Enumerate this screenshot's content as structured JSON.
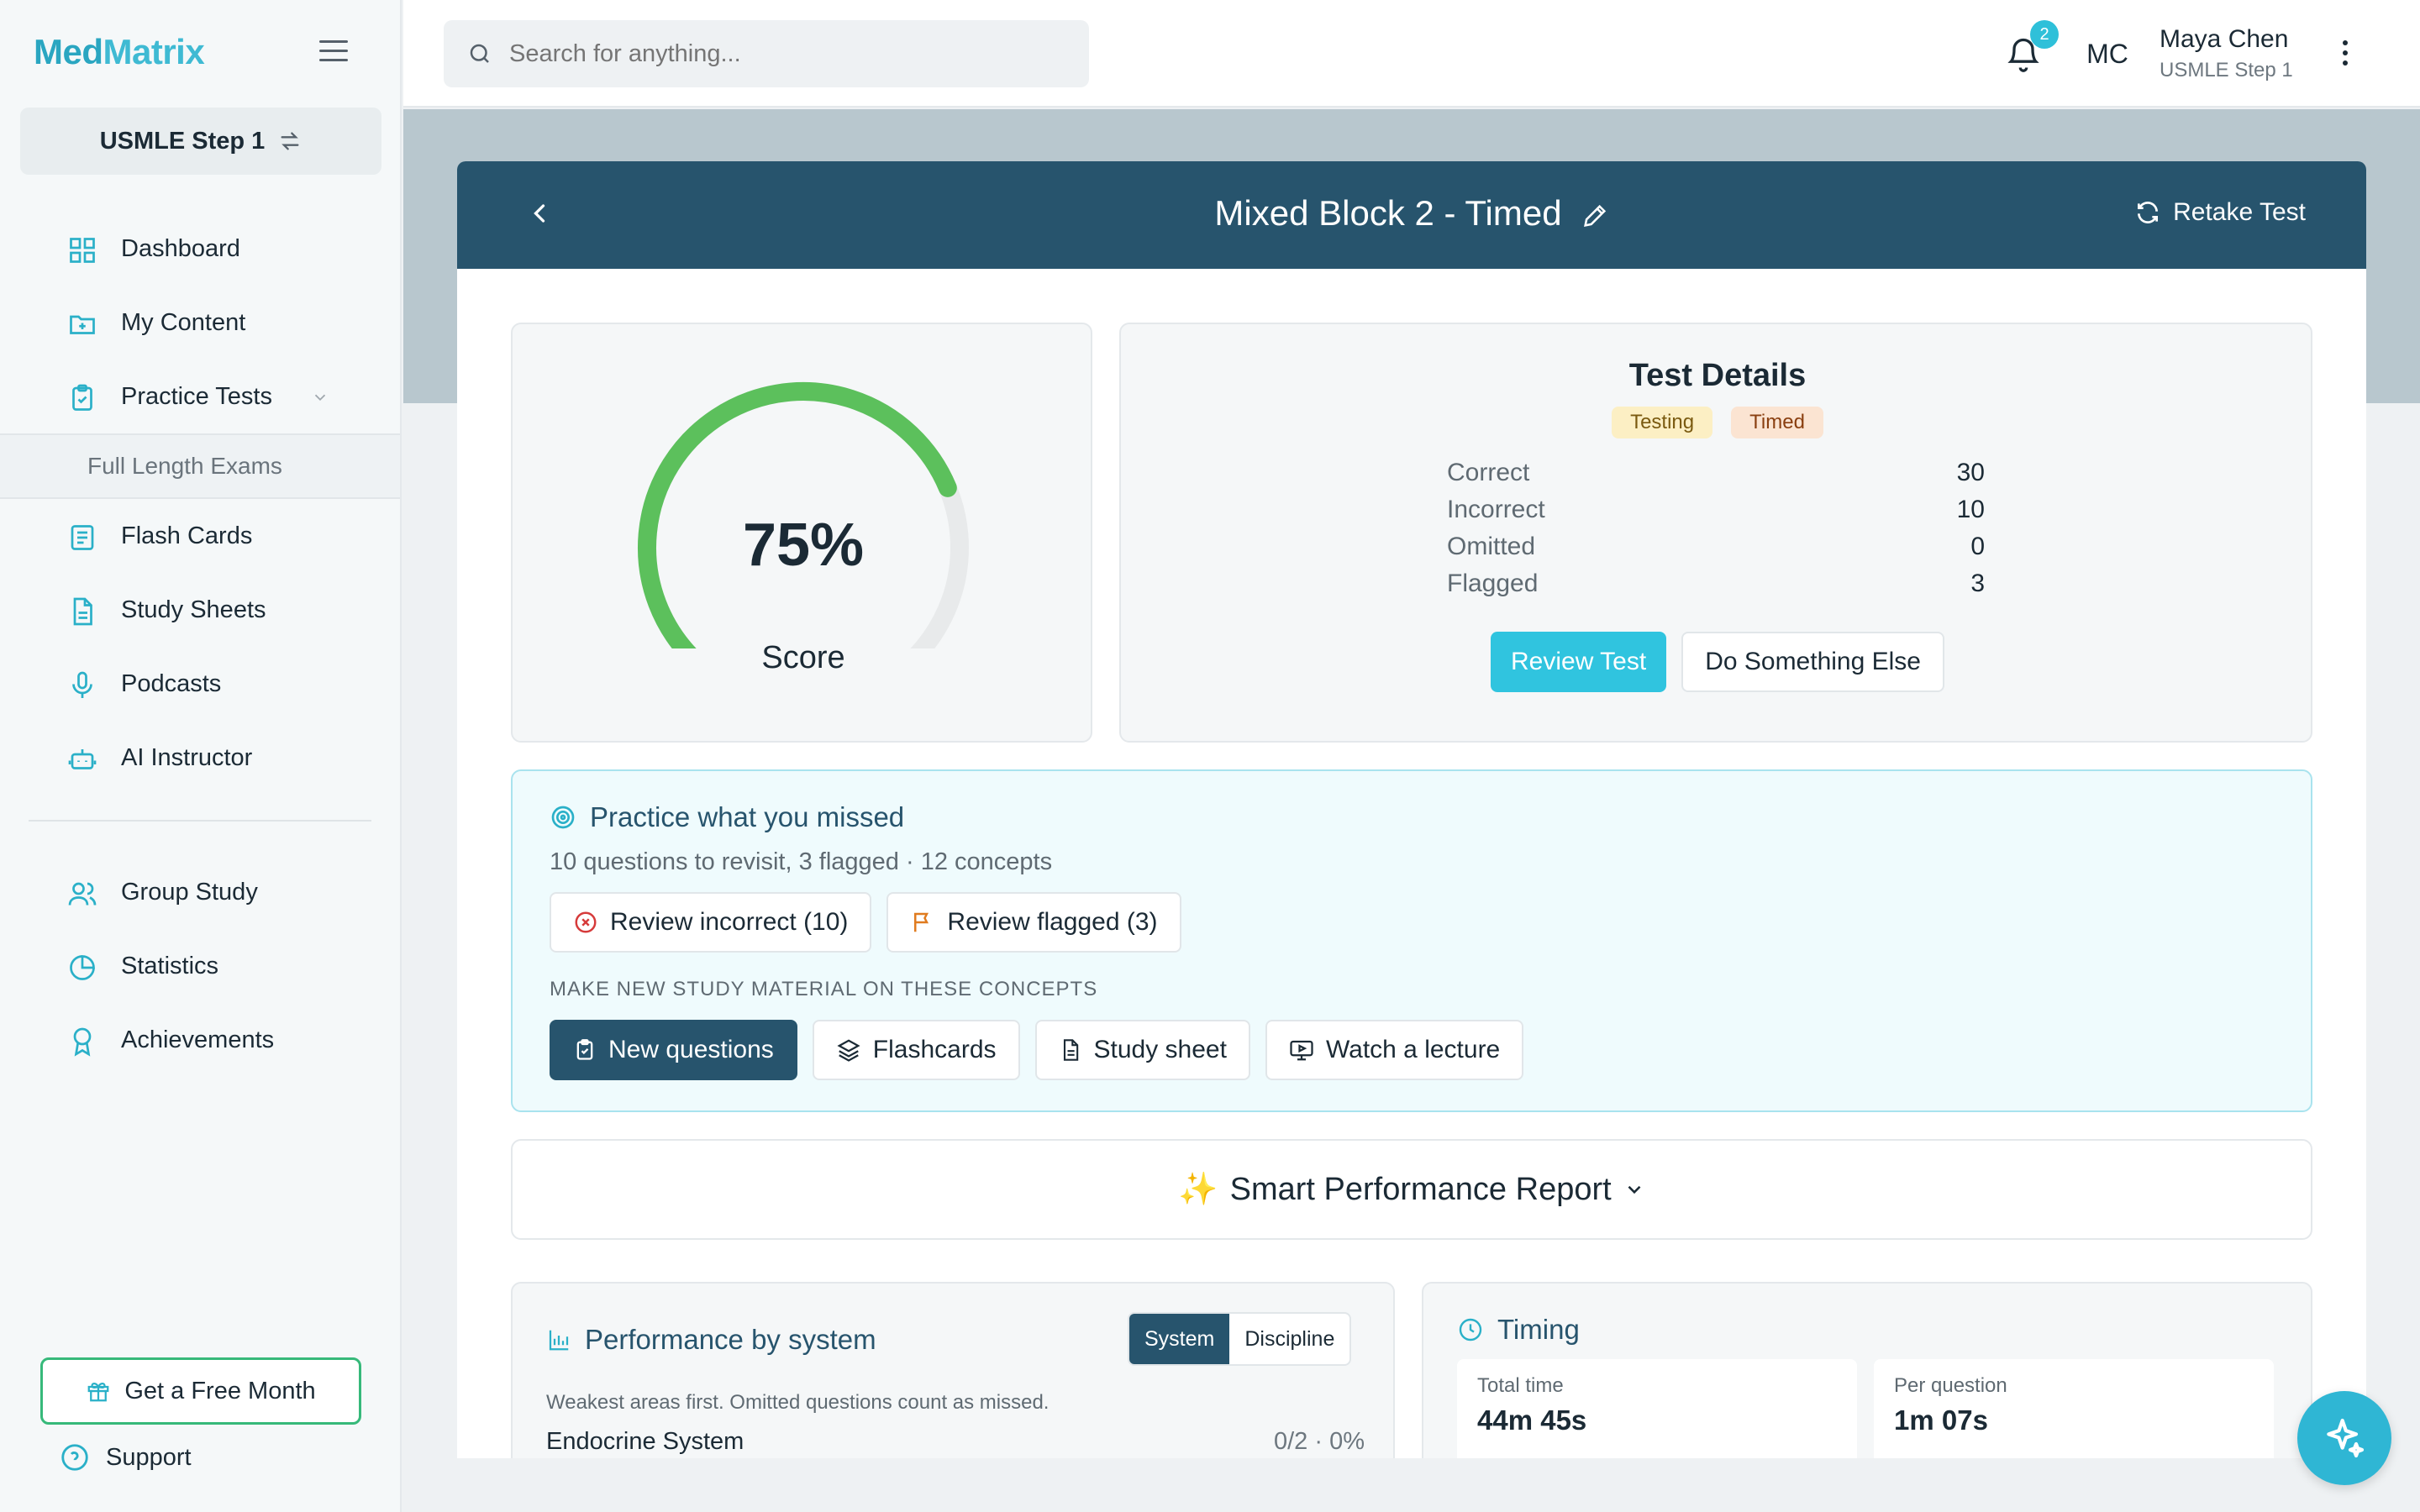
{
  "app": {
    "logo_a": "Med",
    "logo_b": "Matrix",
    "exam_switch": "USMLE Step 1"
  },
  "sidebar": {
    "items": [
      {
        "label": "Dashboard",
        "icon": "grid-icon"
      },
      {
        "label": "My Content",
        "icon": "folder-plus-icon"
      },
      {
        "label": "Practice Tests",
        "icon": "clipboard-check-icon"
      },
      {
        "label": "Full Length Exams"
      },
      {
        "label": "Flash Cards",
        "icon": "cards-icon"
      },
      {
        "label": "Study Sheets",
        "icon": "document-icon"
      },
      {
        "label": "Podcasts",
        "icon": "microphone-icon"
      },
      {
        "label": "AI Instructor",
        "icon": "robot-icon"
      },
      {
        "label": "Group Study",
        "icon": "users-icon"
      },
      {
        "label": "Statistics",
        "icon": "pie-chart-icon"
      },
      {
        "label": "Achievements",
        "icon": "award-icon"
      }
    ],
    "free_month": "Get a Free Month",
    "support": "Support"
  },
  "topbar": {
    "search_placeholder": "Search for anything...",
    "notification_count": "2",
    "avatar_initials": "MC",
    "user_name": "Maya Chen",
    "user_exam": "USMLE Step 1"
  },
  "test": {
    "title": "Mixed Block 2 - Timed",
    "retake": "Retake Test",
    "score": "75%",
    "score_fraction": 0.75,
    "score_label": "Score",
    "details_title": "Test Details",
    "tags": [
      "Testing",
      "Timed"
    ],
    "stats": [
      {
        "label": "Correct",
        "value": "30"
      },
      {
        "label": "Incorrect",
        "value": "10"
      },
      {
        "label": "Omitted",
        "value": "0"
      },
      {
        "label": "Flagged",
        "value": "3"
      }
    ],
    "review_btn": "Review Test",
    "else_btn": "Do Something Else"
  },
  "missed": {
    "title": "Practice what you missed",
    "subtitle": "10 questions to revisit, 3 flagged · 12 concepts",
    "review_incorrect": "Review incorrect (10)",
    "review_flagged": "Review flagged (3)",
    "concept_label": "MAKE NEW STUDY MATERIAL ON THESE CONCEPTS",
    "new_questions": "New questions",
    "flashcards": "Flashcards",
    "study_sheet": "Study sheet",
    "watch_lecture": "Watch a lecture"
  },
  "smart_report": {
    "sparkle": "✨",
    "label": "Smart Performance Report"
  },
  "performance": {
    "title": "Performance by system",
    "seg_system": "System",
    "seg_discipline": "Discipline",
    "subtitle": "Weakest areas first. Omitted questions count as missed.",
    "row_name": "Endocrine System",
    "row_value": "0/2 · 0%"
  },
  "timing": {
    "title": "Timing",
    "total_label": "Total time",
    "total_value": "44m 45s",
    "per_label": "Per question",
    "per_value": "1m 07s"
  },
  "colors": {
    "brand": "#27546d",
    "accent": "#30c4df",
    "gauge_fill": "#5cc05c"
  }
}
